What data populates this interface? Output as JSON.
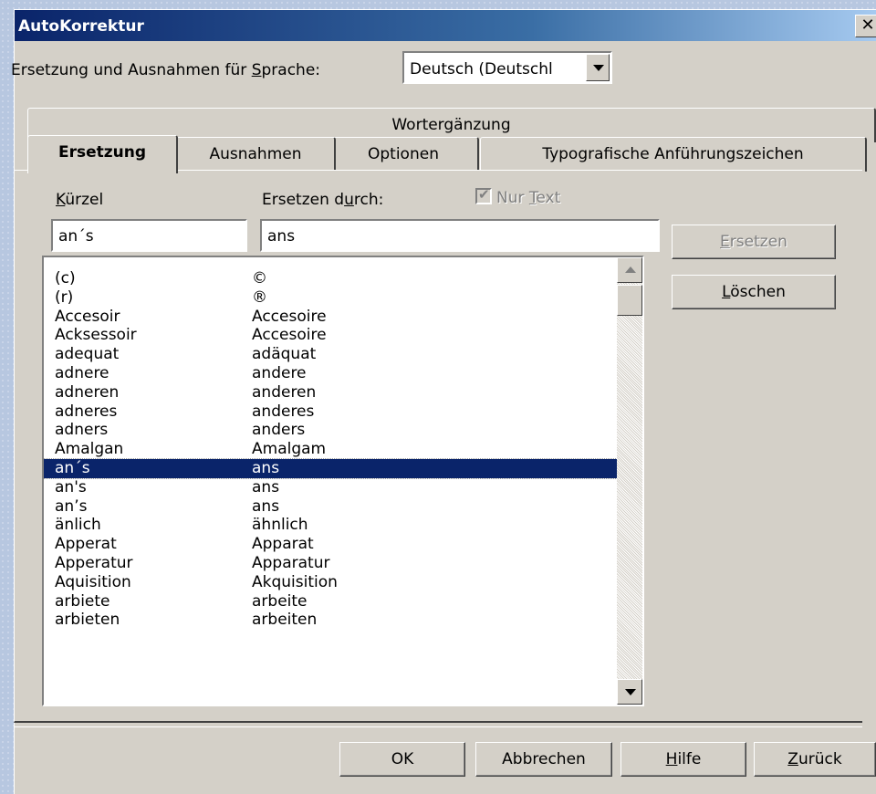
{
  "window": {
    "title": "AutoKorrektur"
  },
  "language": {
    "label_pre": "Ersetzung und Ausnahmen für ",
    "label_ul": "S",
    "label_post": "prache:",
    "value": "Deutsch (Deutschl"
  },
  "tabs": {
    "back_row": [
      {
        "label": "Wortergänzung"
      }
    ],
    "front_row": [
      {
        "label": "Ersetzung"
      },
      {
        "label": "Ausnahmen"
      },
      {
        "label": "Optionen"
      },
      {
        "label": "Typografische Anführungszeichen"
      }
    ]
  },
  "fields": {
    "kuerzel_label_ul": "K",
    "kuerzel_label_rest": "ürzel",
    "ersetzen_label_pre": "Ersetzen d",
    "ersetzen_label_ul": "u",
    "ersetzen_label_post": "rch:",
    "nur_text_pre": "Nur ",
    "nur_text_ul": "T",
    "nur_text_post": "ext",
    "kuerzel_value": "an´s",
    "ersetzen_value": "ans"
  },
  "buttons": {
    "ersetzen_ul": "E",
    "ersetzen_rest": "rsetzen",
    "loeschen_ul": "L",
    "loeschen_rest": "öschen",
    "ok": "OK",
    "abbrechen": "Abbrechen",
    "hilfe_ul": "H",
    "hilfe_rest": "ilfe",
    "zurueck_ul": "Z",
    "zurueck_rest": "urück"
  },
  "entries": [
    {
      "from": "(c)",
      "to": "©"
    },
    {
      "from": "(r)",
      "to": "®"
    },
    {
      "from": "Accesoir",
      "to": "Accesoire"
    },
    {
      "from": "Acksessoir",
      "to": "Accesoire"
    },
    {
      "from": "adequat",
      "to": "adäquat"
    },
    {
      "from": "adnere",
      "to": "andere"
    },
    {
      "from": "adneren",
      "to": "anderen"
    },
    {
      "from": "adneres",
      "to": "anderes"
    },
    {
      "from": "adners",
      "to": "anders"
    },
    {
      "from": "Amalgan",
      "to": "Amalgam"
    },
    {
      "from": "an´s",
      "to": "ans",
      "selected": true
    },
    {
      "from": "an's",
      "to": "ans"
    },
    {
      "from": "an’s",
      "to": "ans"
    },
    {
      "from": "änlich",
      "to": "ähnlich"
    },
    {
      "from": "Apperat",
      "to": "Apparat"
    },
    {
      "from": "Apperatur",
      "to": "Apparatur"
    },
    {
      "from": "Aquisition",
      "to": "Akquisition"
    },
    {
      "from": "arbiete",
      "to": "arbeite"
    },
    {
      "from": "arbieten",
      "to": "arbeiten"
    }
  ]
}
